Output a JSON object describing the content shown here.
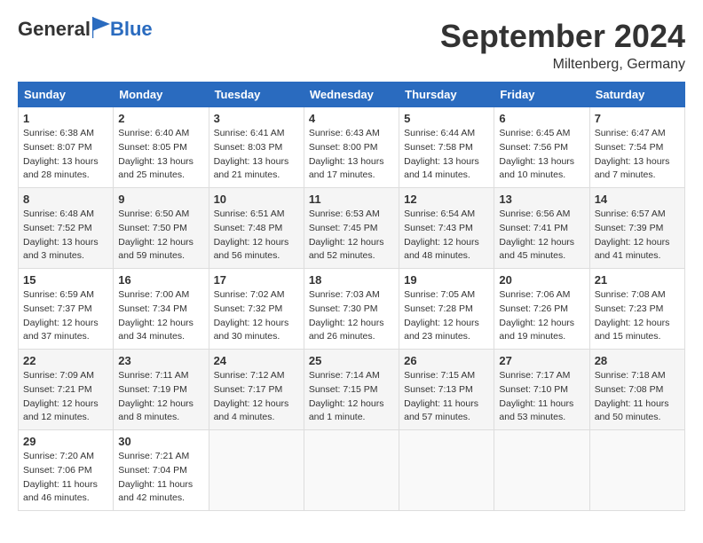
{
  "header": {
    "logo": {
      "general": "General",
      "blue": "Blue"
    },
    "title": "September 2024",
    "location": "Miltenberg, Germany"
  },
  "weekdays": [
    "Sunday",
    "Monday",
    "Tuesday",
    "Wednesday",
    "Thursday",
    "Friday",
    "Saturday"
  ],
  "weeks": [
    [
      {
        "day": "1",
        "info": "Sunrise: 6:38 AM\nSunset: 8:07 PM\nDaylight: 13 hours\nand 28 minutes."
      },
      {
        "day": "2",
        "info": "Sunrise: 6:40 AM\nSunset: 8:05 PM\nDaylight: 13 hours\nand 25 minutes."
      },
      {
        "day": "3",
        "info": "Sunrise: 6:41 AM\nSunset: 8:03 PM\nDaylight: 13 hours\nand 21 minutes."
      },
      {
        "day": "4",
        "info": "Sunrise: 6:43 AM\nSunset: 8:00 PM\nDaylight: 13 hours\nand 17 minutes."
      },
      {
        "day": "5",
        "info": "Sunrise: 6:44 AM\nSunset: 7:58 PM\nDaylight: 13 hours\nand 14 minutes."
      },
      {
        "day": "6",
        "info": "Sunrise: 6:45 AM\nSunset: 7:56 PM\nDaylight: 13 hours\nand 10 minutes."
      },
      {
        "day": "7",
        "info": "Sunrise: 6:47 AM\nSunset: 7:54 PM\nDaylight: 13 hours\nand 7 minutes."
      }
    ],
    [
      {
        "day": "8",
        "info": "Sunrise: 6:48 AM\nSunset: 7:52 PM\nDaylight: 13 hours\nand 3 minutes."
      },
      {
        "day": "9",
        "info": "Sunrise: 6:50 AM\nSunset: 7:50 PM\nDaylight: 12 hours\nand 59 minutes."
      },
      {
        "day": "10",
        "info": "Sunrise: 6:51 AM\nSunset: 7:48 PM\nDaylight: 12 hours\nand 56 minutes."
      },
      {
        "day": "11",
        "info": "Sunrise: 6:53 AM\nSunset: 7:45 PM\nDaylight: 12 hours\nand 52 minutes."
      },
      {
        "day": "12",
        "info": "Sunrise: 6:54 AM\nSunset: 7:43 PM\nDaylight: 12 hours\nand 48 minutes."
      },
      {
        "day": "13",
        "info": "Sunrise: 6:56 AM\nSunset: 7:41 PM\nDaylight: 12 hours\nand 45 minutes."
      },
      {
        "day": "14",
        "info": "Sunrise: 6:57 AM\nSunset: 7:39 PM\nDaylight: 12 hours\nand 41 minutes."
      }
    ],
    [
      {
        "day": "15",
        "info": "Sunrise: 6:59 AM\nSunset: 7:37 PM\nDaylight: 12 hours\nand 37 minutes."
      },
      {
        "day": "16",
        "info": "Sunrise: 7:00 AM\nSunset: 7:34 PM\nDaylight: 12 hours\nand 34 minutes."
      },
      {
        "day": "17",
        "info": "Sunrise: 7:02 AM\nSunset: 7:32 PM\nDaylight: 12 hours\nand 30 minutes."
      },
      {
        "day": "18",
        "info": "Sunrise: 7:03 AM\nSunset: 7:30 PM\nDaylight: 12 hours\nand 26 minutes."
      },
      {
        "day": "19",
        "info": "Sunrise: 7:05 AM\nSunset: 7:28 PM\nDaylight: 12 hours\nand 23 minutes."
      },
      {
        "day": "20",
        "info": "Sunrise: 7:06 AM\nSunset: 7:26 PM\nDaylight: 12 hours\nand 19 minutes."
      },
      {
        "day": "21",
        "info": "Sunrise: 7:08 AM\nSunset: 7:23 PM\nDaylight: 12 hours\nand 15 minutes."
      }
    ],
    [
      {
        "day": "22",
        "info": "Sunrise: 7:09 AM\nSunset: 7:21 PM\nDaylight: 12 hours\nand 12 minutes."
      },
      {
        "day": "23",
        "info": "Sunrise: 7:11 AM\nSunset: 7:19 PM\nDaylight: 12 hours\nand 8 minutes."
      },
      {
        "day": "24",
        "info": "Sunrise: 7:12 AM\nSunset: 7:17 PM\nDaylight: 12 hours\nand 4 minutes."
      },
      {
        "day": "25",
        "info": "Sunrise: 7:14 AM\nSunset: 7:15 PM\nDaylight: 12 hours\nand 1 minute."
      },
      {
        "day": "26",
        "info": "Sunrise: 7:15 AM\nSunset: 7:13 PM\nDaylight: 11 hours\nand 57 minutes."
      },
      {
        "day": "27",
        "info": "Sunrise: 7:17 AM\nSunset: 7:10 PM\nDaylight: 11 hours\nand 53 minutes."
      },
      {
        "day": "28",
        "info": "Sunrise: 7:18 AM\nSunset: 7:08 PM\nDaylight: 11 hours\nand 50 minutes."
      }
    ],
    [
      {
        "day": "29",
        "info": "Sunrise: 7:20 AM\nSunset: 7:06 PM\nDaylight: 11 hours\nand 46 minutes."
      },
      {
        "day": "30",
        "info": "Sunrise: 7:21 AM\nSunset: 7:04 PM\nDaylight: 11 hours\nand 42 minutes."
      },
      {
        "day": "",
        "info": ""
      },
      {
        "day": "",
        "info": ""
      },
      {
        "day": "",
        "info": ""
      },
      {
        "day": "",
        "info": ""
      },
      {
        "day": "",
        "info": ""
      }
    ]
  ]
}
